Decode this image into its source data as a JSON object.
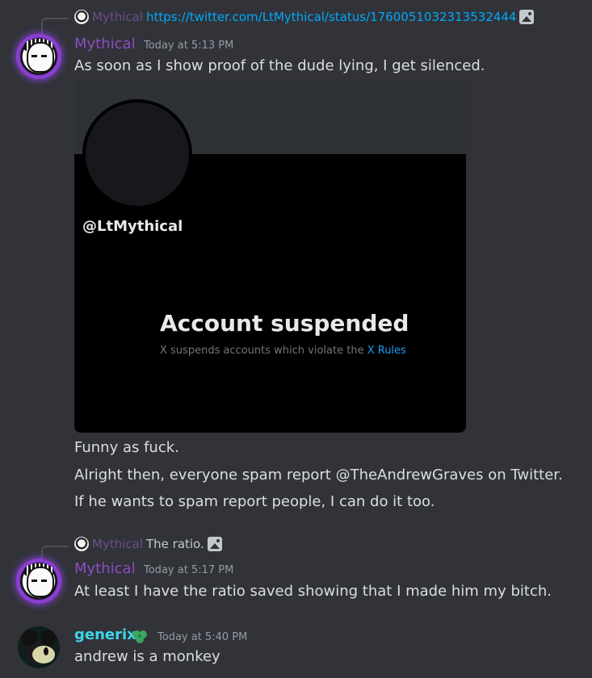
{
  "messages": [
    {
      "reply": {
        "name": "Mythical",
        "text": "https://twitter.com/LtMythical/status/1760051032313532444"
      },
      "author": "Mythical",
      "timestamp": "Today at 5:13 PM",
      "lines": [
        "As soon as I show proof of the dude lying, I get silenced."
      ],
      "embed": {
        "handle": "@LtMythical",
        "title": "Account suspended",
        "subtitle": "X suspends accounts which violate the ",
        "rules_link": "X Rules"
      },
      "after_lines": [
        "Funny as fuck.",
        "Alright then, everyone spam report @TheAndrewGraves on Twitter.",
        "If he wants to spam report people, I can do it too."
      ]
    },
    {
      "reply": {
        "name": "Mythical",
        "text": "The ratio."
      },
      "author": "Mythical",
      "timestamp": "Today at 5:17 PM",
      "lines": [
        "At least I have the ratio saved showing that I made him my bitch."
      ]
    },
    {
      "author": "generix",
      "badge_icon": "leaf-icon",
      "timestamp": "Today at 5:40 PM",
      "lines": [
        "andrew is a monkey"
      ]
    }
  ],
  "colors": {
    "background": "#313338",
    "mythical_name": "#8e4cc4",
    "generix_name": "#3ed6e8",
    "link": "#00a8fc"
  }
}
